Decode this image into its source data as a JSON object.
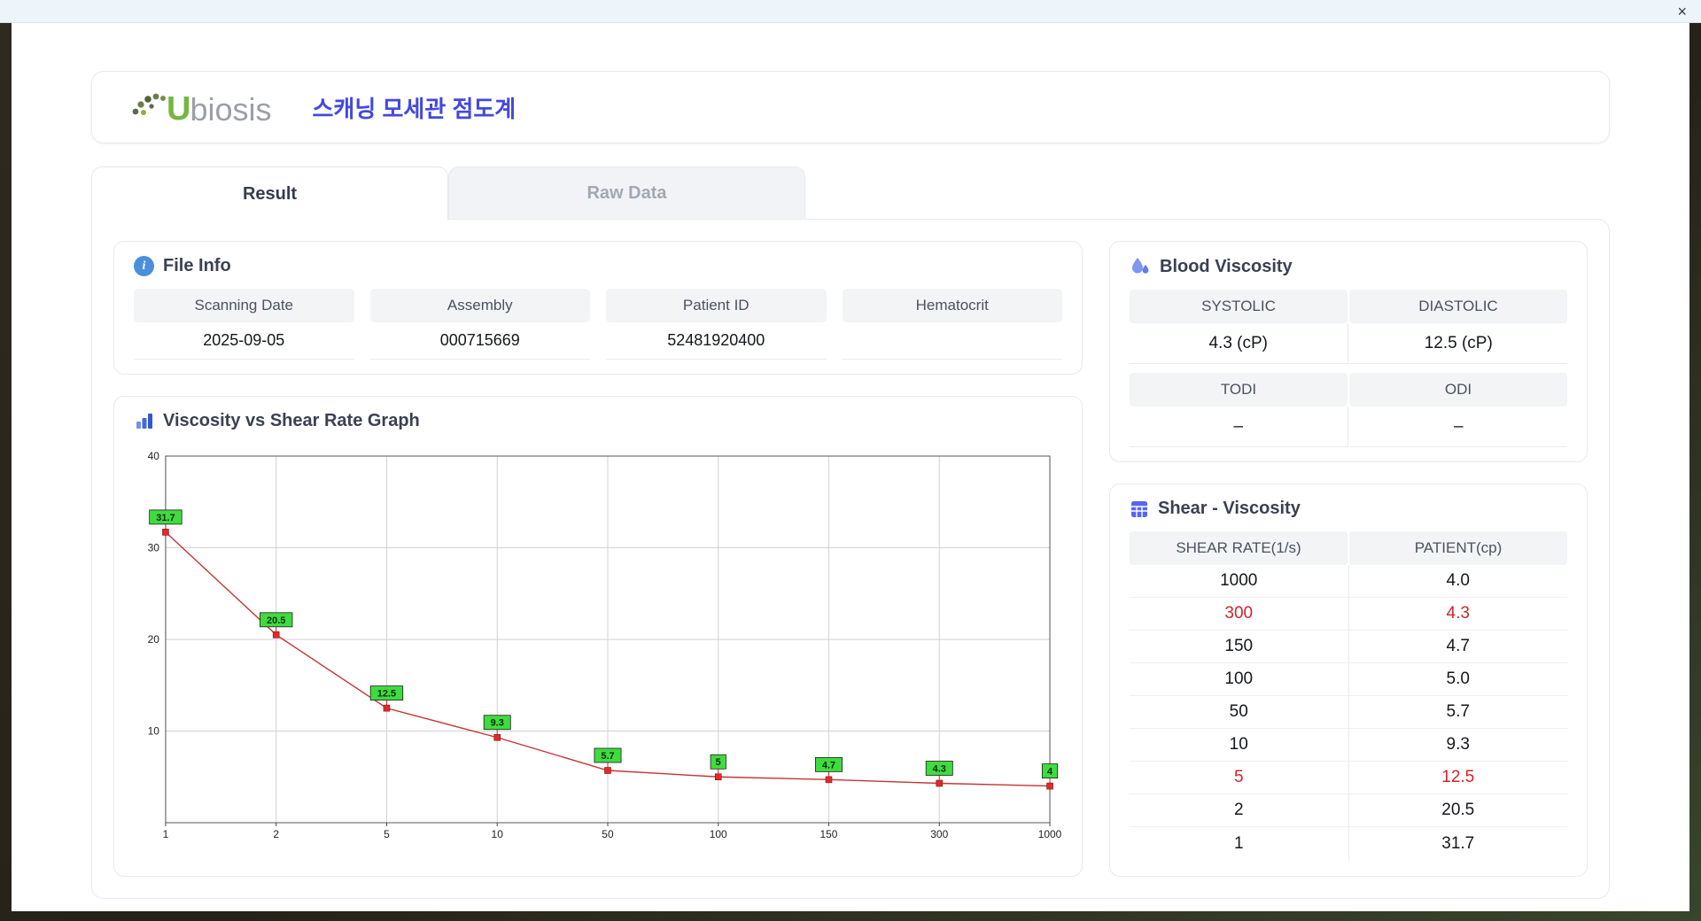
{
  "window": {
    "close_label": "×"
  },
  "header": {
    "logo_u": "U",
    "logo_rest": "biosis",
    "title": "스캐닝 모세관 점도계"
  },
  "tabs": [
    {
      "label": "Result",
      "active": true
    },
    {
      "label": "Raw Data",
      "active": false
    }
  ],
  "file_info": {
    "title": "File Info",
    "fields": [
      {
        "label": "Scanning Date",
        "value": "2025-09-05"
      },
      {
        "label": "Assembly",
        "value": "000715669"
      },
      {
        "label": "Patient ID",
        "value": "52481920400"
      },
      {
        "label": "Hematocrit",
        "value": ""
      }
    ]
  },
  "graph": {
    "title": "Viscosity vs Shear Rate Graph"
  },
  "chart_data": {
    "type": "line",
    "title": "Viscosity vs Shear Rate Graph",
    "x_scale": "category",
    "x_ticks": [
      "1",
      "2",
      "5",
      "10",
      "50",
      "100",
      "150",
      "300",
      "1000"
    ],
    "x": [
      1,
      2,
      5,
      10,
      50,
      100,
      150,
      300,
      1000
    ],
    "values": [
      31.7,
      20.5,
      12.5,
      9.3,
      5.7,
      5,
      4.7,
      4.3,
      4
    ],
    "point_labels": [
      "31.7",
      "20.5",
      "12.5",
      "9.3",
      "5.7",
      "5",
      "4.7",
      "4.3",
      "4"
    ],
    "xlabel": "",
    "ylabel": "",
    "ylim": [
      0,
      40
    ],
    "y_ticks": [
      10,
      20,
      30,
      40
    ],
    "grid": true,
    "legend": "none",
    "line_color": "#c63434",
    "marker_color": "#e02a2a",
    "label_bg": "#3fdc3f"
  },
  "blood_viscosity": {
    "title": "Blood Viscosity",
    "groups": [
      {
        "headers": [
          "SYSTOLIC",
          "DIASTOLIC"
        ],
        "values": [
          "4.3 (cP)",
          "12.5 (cP)"
        ]
      },
      {
        "headers": [
          "TODI",
          "ODI"
        ],
        "values": [
          "–",
          "–"
        ]
      }
    ]
  },
  "shear_viscosity": {
    "title": "Shear - Viscosity",
    "headers": [
      "SHEAR RATE(1/s)",
      "PATIENT(cp)"
    ],
    "rows": [
      {
        "shear": "1000",
        "patient": "4.0",
        "highlight": false
      },
      {
        "shear": "300",
        "patient": "4.3",
        "highlight": true
      },
      {
        "shear": "150",
        "patient": "4.7",
        "highlight": false
      },
      {
        "shear": "100",
        "patient": "5.0",
        "highlight": false
      },
      {
        "shear": "50",
        "patient": "5.7",
        "highlight": false
      },
      {
        "shear": "10",
        "patient": "9.3",
        "highlight": false
      },
      {
        "shear": "5",
        "patient": "12.5",
        "highlight": true
      },
      {
        "shear": "2",
        "patient": "20.5",
        "highlight": false
      },
      {
        "shear": "1",
        "patient": "31.7",
        "highlight": false
      }
    ]
  },
  "colors": {
    "accent_blue": "#4348e0",
    "highlight_red": "#d3232a",
    "label_green": "#3fdc3f",
    "logo_green": "#76b63e"
  }
}
